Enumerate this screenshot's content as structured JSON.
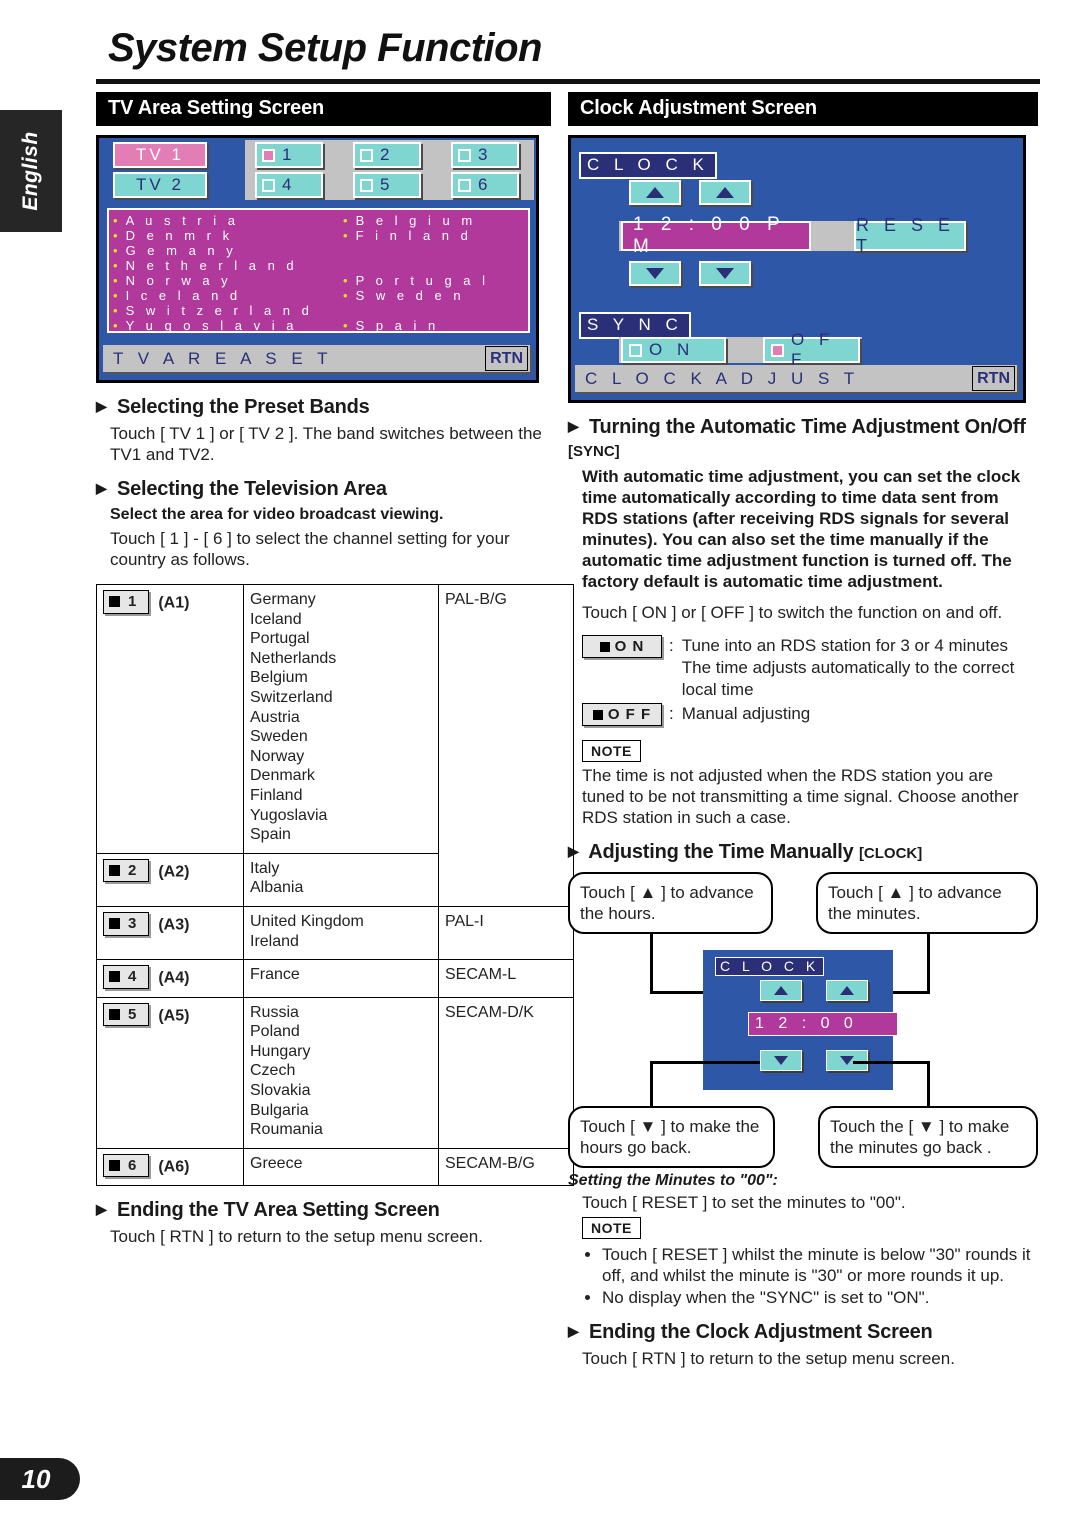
{
  "page": {
    "title": "System Setup Function",
    "language_tab": "English",
    "number": "10"
  },
  "left": {
    "section_title": "TV Area Setting Screen",
    "screen": {
      "band_buttons": [
        {
          "label": "TV 1",
          "selected": true
        },
        {
          "label": "TV 2",
          "selected": false
        }
      ],
      "preset_buttons": [
        {
          "label": "1",
          "selected": true
        },
        {
          "label": "2",
          "selected": false
        },
        {
          "label": "3",
          "selected": false
        },
        {
          "label": "4",
          "selected": false
        },
        {
          "label": "5",
          "selected": false
        },
        {
          "label": "6",
          "selected": false
        }
      ],
      "country_list": [
        {
          "left": "A u s t r i a",
          "right": "B e l g i u m"
        },
        {
          "left": "D e n m r k",
          "right": "F i n l a n d"
        },
        {
          "left": "G e m a n y",
          "right": ""
        },
        {
          "left": "N e t h e r l a n d",
          "right": ""
        },
        {
          "left": "N o r w a y",
          "right": "P o r t u g a l"
        },
        {
          "left": "I c e l a n d",
          "right": "S w e d e n"
        },
        {
          "left": "S w i t z e r l a n d",
          "right": ""
        },
        {
          "left": "Y u g o s l a v i a",
          "right": "S p a i n"
        }
      ],
      "bottom_label": "T V   A R E A   S E T",
      "return_button": "RTN"
    },
    "preset_bands": {
      "heading": "Selecting the Preset Bands",
      "body": "Touch [ TV 1 ] or [ TV 2 ]. The band switches between the TV1 and TV2."
    },
    "television_area": {
      "heading": "Selecting the Television Area",
      "bold": "Select the area for video broadcast viewing.",
      "body": "Touch [ 1 ] - [ 6 ] to select the channel setting for your country as follows."
    },
    "table": [
      {
        "num": "1",
        "aref": "(A1)",
        "countries": [
          "Germany",
          "Iceland",
          "Portugal",
          "Netherlands",
          "Belgium",
          "Switzerland",
          "Austria",
          "Sweden",
          "Norway",
          "Denmark",
          "Finland",
          "Yugoslavia",
          "Spain"
        ],
        "system": "PAL-B/G"
      },
      {
        "num": "2",
        "aref": "(A2)",
        "countries": [
          "Italy",
          "Albania"
        ],
        "system": ""
      },
      {
        "num": "3",
        "aref": "(A3)",
        "countries": [
          "United Kingdom",
          "Ireland"
        ],
        "system": "PAL-I"
      },
      {
        "num": "4",
        "aref": "(A4)",
        "countries": [
          "France"
        ],
        "system": "SECAM-L"
      },
      {
        "num": "5",
        "aref": "(A5)",
        "countries": [
          "Russia",
          "Poland",
          "Hungary",
          "Czech",
          "Slovakia",
          "Bulgaria",
          "Roumania"
        ],
        "system": "SECAM-D/K"
      },
      {
        "num": "6",
        "aref": "(A6)",
        "countries": [
          "Greece"
        ],
        "system": "SECAM-B/G"
      }
    ],
    "ending": {
      "heading": "Ending the TV Area Setting Screen",
      "body": "Touch [ RTN ] to return to the setup menu screen."
    }
  },
  "right": {
    "section_title": "Clock Adjustment Screen",
    "screen": {
      "clock_tag": "C L O C K",
      "time_value": "1 2 : 0 0   P M",
      "reset_button": "R E S E T",
      "sync_tag": "S Y N C",
      "on_button": {
        "label": "O   N",
        "selected": false
      },
      "off_button": {
        "label": "O F F",
        "selected": true
      },
      "bottom_label": "C L O C K   A D J U S T",
      "return_button": "RTN"
    },
    "sync_section": {
      "heading": "Turning the Automatic Time Adjustment On/Off",
      "heading_key": "[SYNC]",
      "bold_block": "With automatic time adjustment, you can set the clock time automatically according to time data sent from RDS stations (after receiving RDS signals for several minutes). You can also set the time manually if the automatic time adjustment function is turned off. The factory default is automatic time adjustment.",
      "body": "Touch [ ON ] or [ OFF ] to switch the function on and off.",
      "definitions": [
        {
          "key": "O     N",
          "desc": "Tune into an RDS station for 3 or 4 minutes\nThe time adjusts automatically to the correct local time"
        },
        {
          "key": "O F F",
          "desc": "Manual adjusting"
        }
      ],
      "note_tag": "NOTE",
      "note": "The time is not adjusted when the RDS station you are tuned to be not transmitting a time signal. Choose another RDS station in such a case."
    },
    "manual_section": {
      "heading": "Adjusting the Time Manually",
      "heading_key": "[CLOCK]",
      "callouts": {
        "top_left": "Touch [ ▲ ] to advance the hours.",
        "top_right": "Touch [ ▲ ] to advance the minutes.",
        "bottom_left": "Touch [ ▼ ] to make the hours go back.",
        "bottom_right": "Touch the [ ▼ ] to make the minutes go back ."
      },
      "mini_screen": {
        "clock_tag": "C L O C K",
        "time_value": "1 2 : 0 0"
      },
      "minutes_subhead": "Setting the Minutes to \"00\":",
      "minutes_body": "Touch [ RESET ] to set the minutes to \"00\".",
      "note_tag": "NOTE",
      "notes": [
        "Touch [ RESET ] whilst the minute is below \"30\" rounds it off, and whilst the minute is \"30\" or more rounds it up.",
        "No display when the \"SYNC\" is set to \"ON\"."
      ]
    },
    "ending": {
      "heading": "Ending the Clock Adjustment Screen",
      "body": "Touch [ RTN ] to return to the setup menu screen."
    }
  }
}
